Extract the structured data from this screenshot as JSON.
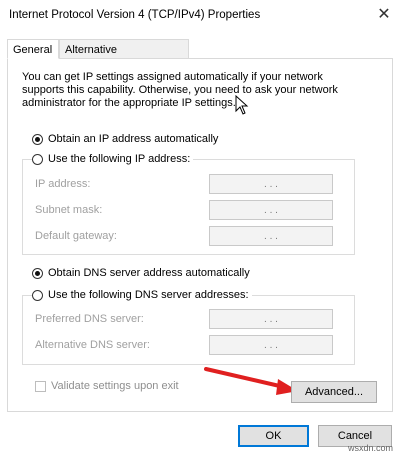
{
  "window": {
    "title": "Internet Protocol Version 4 (TCP/IPv4) Properties",
    "close_glyph": "✕"
  },
  "tabs": [
    {
      "label": "General",
      "active": true
    },
    {
      "label": "Alternative Configuration",
      "active": false
    }
  ],
  "intro_text": "You can get IP settings assigned automatically if your network supports this capability. Otherwise, you need to ask your network administrator for the appropriate IP settings.",
  "ip_mode": {
    "auto_label": "Obtain an IP address automatically",
    "manual_label": "Use the following IP address:",
    "selected": "auto"
  },
  "ip_fields": [
    {
      "label": "IP address:",
      "value": ". . ."
    },
    {
      "label": "Subnet mask:",
      "value": ". . ."
    },
    {
      "label": "Default gateway:",
      "value": ". . ."
    }
  ],
  "dns_mode": {
    "auto_label": "Obtain DNS server address automatically",
    "manual_label": "Use the following DNS server addresses:",
    "selected": "auto"
  },
  "dns_fields": [
    {
      "label": "Preferred DNS server:",
      "value": ". . ."
    },
    {
      "label": "Alternative DNS server:",
      "value": ". . ."
    }
  ],
  "validate": {
    "label": "Validate settings upon exit",
    "checked": false,
    "enabled": false
  },
  "buttons": {
    "advanced": "Advanced...",
    "ok": "OK",
    "cancel": "Cancel"
  },
  "annotation": {
    "arrow_color": "#e02020"
  },
  "watermark": "wsxdn.com"
}
